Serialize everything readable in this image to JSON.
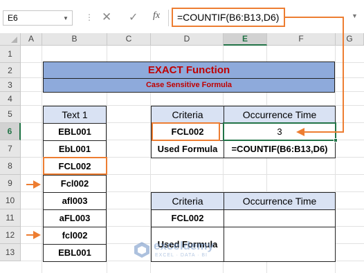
{
  "formula_bar": {
    "name_box": "E6",
    "cancel_icon": "✕",
    "enter_icon": "✓",
    "fx_label": "fx",
    "formula": "=COUNTIF(B6:B13,D6)"
  },
  "columns": [
    "A",
    "B",
    "C",
    "D",
    "E",
    "F",
    "G"
  ],
  "rows": [
    "1",
    "2",
    "3",
    "4",
    "5",
    "6",
    "7",
    "8",
    "9",
    "10",
    "11",
    "12",
    "13"
  ],
  "selected_column": "E",
  "selected_row": "6",
  "title": {
    "main": "EXACT Function",
    "subtitle": "Case Sensitive Formula"
  },
  "text_list": {
    "header": "Text 1",
    "items": [
      "EBL001",
      "EbL001",
      "FCL002",
      "Fcl002",
      "afl003",
      "aFL003",
      "fcl002",
      "EBL001"
    ]
  },
  "table1": {
    "criteria_header": "Criteria",
    "occurrence_header": "Occurrence Time",
    "criteria_value": "FCL002",
    "result_value": "3",
    "formula_label": "Used Formula",
    "formula_value": "=COUNTIF(B6:B13,D6)"
  },
  "table2": {
    "criteria_header": "Criteria",
    "occurrence_header": "Occurrence Time",
    "criteria_value": "FCL002",
    "formula_label": "Used Formula"
  },
  "watermark": {
    "name": "exceldemy",
    "tagline": "EXCEL · DATA · BI"
  },
  "colors": {
    "accent_orange": "#ed7d31",
    "title_fill": "#8eaadb",
    "header_fill": "#d9e2f3",
    "title_text": "#c00000",
    "excel_green": "#217346"
  }
}
